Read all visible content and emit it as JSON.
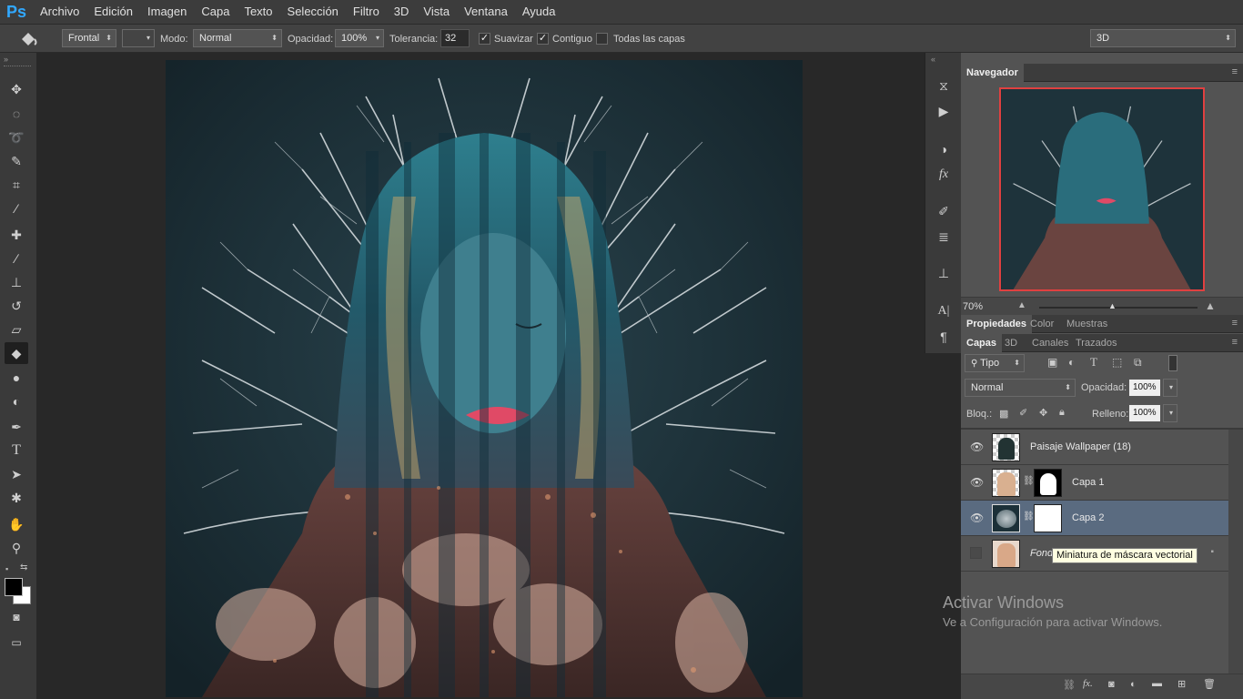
{
  "app_logo": "Ps",
  "menu": [
    "Archivo",
    "Edición",
    "Imagen",
    "Capa",
    "Texto",
    "Selección",
    "Filtro",
    "3D",
    "Vista",
    "Ventana",
    "Ayuda"
  ],
  "options": {
    "tool_icon": "paint-bucket-icon",
    "fill_source": "Frontal",
    "mode_label": "Modo:",
    "mode_value": "Normal",
    "opacity_label": "Opacidad:",
    "opacity_value": "100%",
    "tolerance_label": "Tolerancia:",
    "tolerance_value": "32",
    "antialias_label": "Suavizar",
    "antialias_checked": true,
    "contiguous_label": "Contiguo",
    "contiguous_checked": true,
    "all_layers_label": "Todas las capas",
    "all_layers_checked": false,
    "workspace_value": "3D"
  },
  "tools": [
    "move-icon",
    "elliptical-marquee-icon",
    "lasso-icon",
    "quick-selection-icon",
    "crop-icon",
    "eyedropper-icon",
    "healing-brush-icon",
    "brush-icon",
    "clone-stamp-icon",
    "history-brush-icon",
    "eraser-icon",
    "paint-bucket-icon",
    "blur-icon",
    "dodge-icon",
    "pen-icon",
    "type-icon",
    "path-selection-icon",
    "custom-shape-icon",
    "hand-icon",
    "zoom-icon"
  ],
  "colors": {
    "foreground": "#000000",
    "background": "#ffffff",
    "accent_selected_layer": "#5a6b80",
    "navigator_frame": "#e04040",
    "app_bg": "#282828"
  },
  "navigator": {
    "tab_label": "Navegador",
    "zoom": "70%"
  },
  "properties_tabs": [
    "Propiedades",
    "Color",
    "Muestras"
  ],
  "layers_panel": {
    "tabs": [
      "Capas",
      "3D",
      "Canales",
      "Trazados"
    ],
    "filter_label": "Tipo",
    "blend_mode": "Normal",
    "opacity_label": "Opacidad:",
    "opacity_value": "100%",
    "lock_label": "Bloq.:",
    "fill_label": "Relleno:",
    "fill_value": "100%",
    "layers": [
      {
        "name": "Paisaje Wallpaper (18)",
        "visible": true,
        "has_mask": false,
        "selected": false
      },
      {
        "name": "Capa 1",
        "visible": true,
        "has_mask": true,
        "selected": false
      },
      {
        "name": "Capa 2",
        "visible": true,
        "has_mask": true,
        "selected": true
      },
      {
        "name": "Fondo",
        "visible": false,
        "has_mask": false,
        "selected": false
      }
    ],
    "tooltip": "Miniatura de máscara vectorial"
  },
  "watermark": {
    "title": "Activar Windows",
    "subtitle": "Ve a Configuración para activar Windows."
  }
}
